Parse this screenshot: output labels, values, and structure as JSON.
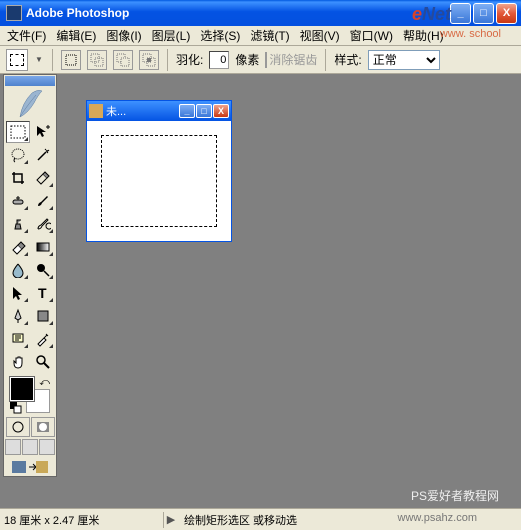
{
  "titlebar": {
    "app_name": "Adobe Photoshop"
  },
  "menu": {
    "file": "文件(F)",
    "edit": "编辑(E)",
    "image": "图像(I)",
    "layer": "图层(L)",
    "select": "选择(S)",
    "filter": "滤镜(T)",
    "view": "视图(V)",
    "window": "窗口(W)",
    "help": "帮助(H)"
  },
  "optbar": {
    "feather_label": "羽化:",
    "feather_value": "0",
    "feather_unit": "像素",
    "antialias": "消除锯齿",
    "style_label": "样式:",
    "style_value": "正常"
  },
  "document": {
    "title": "未..."
  },
  "status": {
    "size": "18 厘米 x 2.47 厘米",
    "hint": "绘制矩形选区 或移动选"
  },
  "watermarks": {
    "enet_e": "e",
    "enet_net": "Net",
    "school": "www.            school",
    "ps": "PS爱好者教程网",
    "url": "www.psahz.com"
  }
}
